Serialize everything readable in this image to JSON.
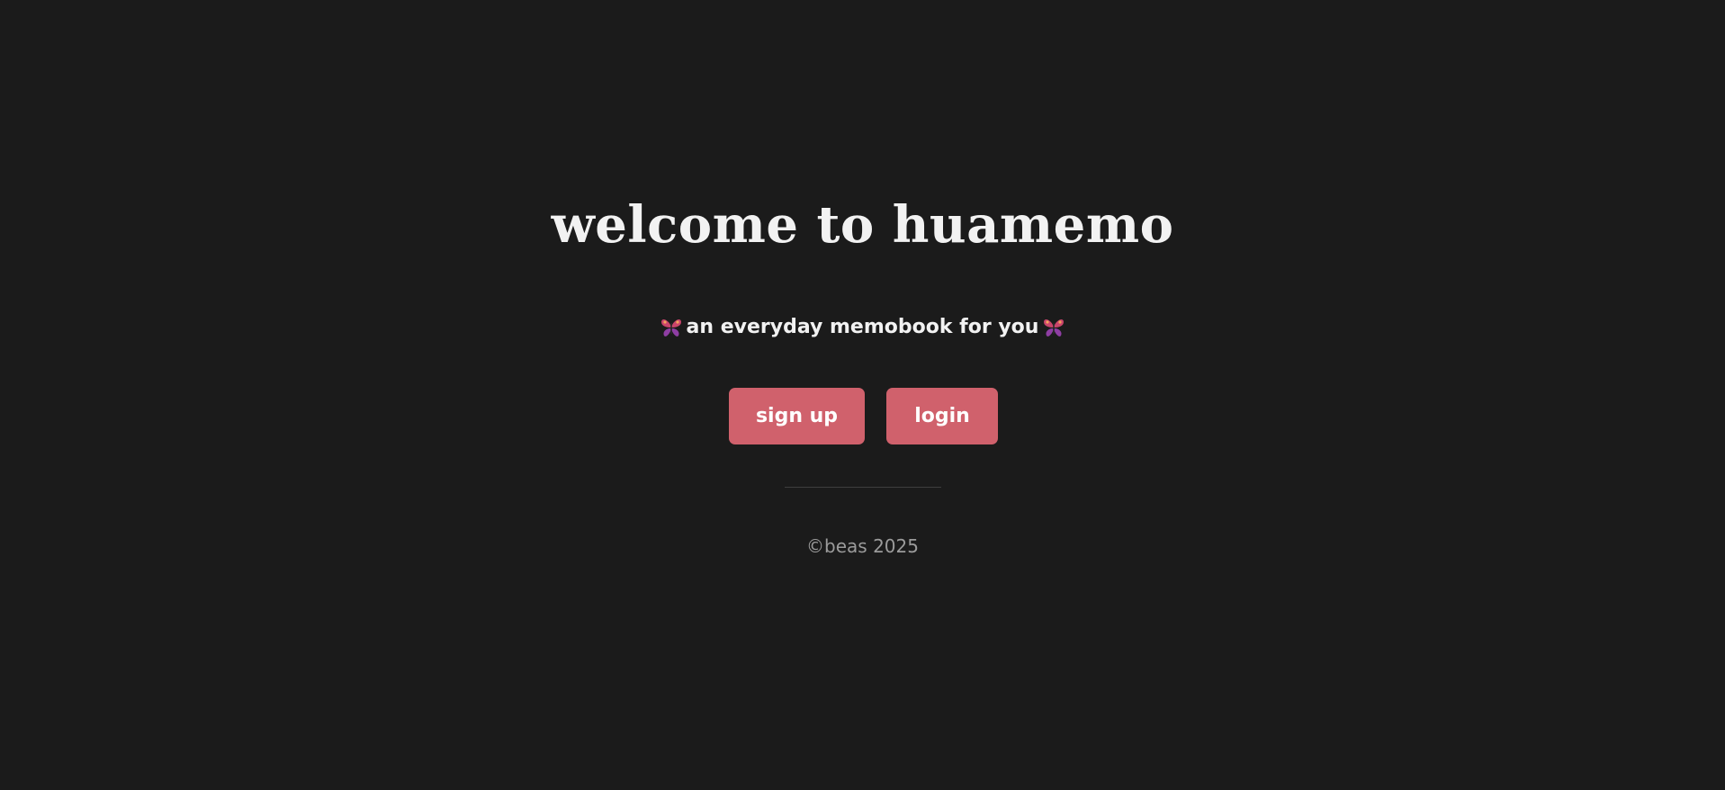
{
  "page": {
    "title": "welcome to huamemo",
    "tagline": "an everyday memobook for you",
    "tagline_icon": "butterfly-icon"
  },
  "actions": {
    "signup_label": "sign up",
    "login_label": "login"
  },
  "footer": {
    "copyright": "©beas 2025"
  },
  "colors": {
    "background": "#1b1b1b",
    "text": "#f2f2f2",
    "button": "#d0616c",
    "button_text": "#ffffff",
    "muted": "#9b9b9b",
    "divider": "#3e3e3e"
  }
}
